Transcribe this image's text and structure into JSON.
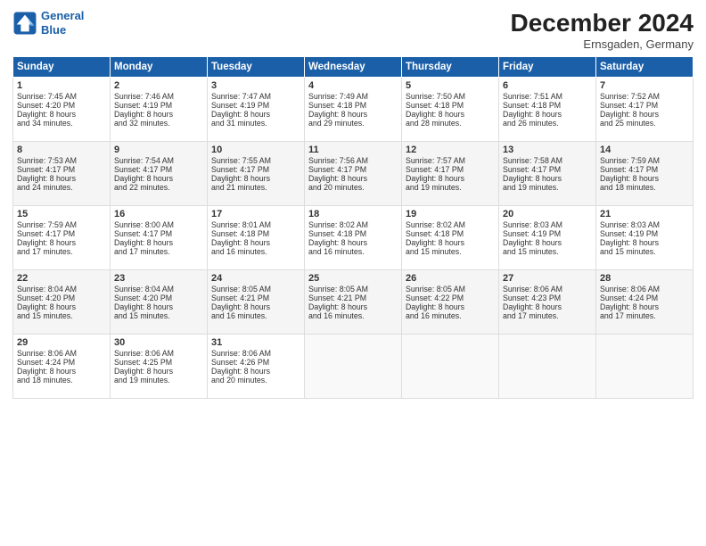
{
  "header": {
    "logo_line1": "General",
    "logo_line2": "Blue",
    "month": "December 2024",
    "location": "Ernsgaden, Germany"
  },
  "days_of_week": [
    "Sunday",
    "Monday",
    "Tuesday",
    "Wednesday",
    "Thursday",
    "Friday",
    "Saturday"
  ],
  "weeks": [
    [
      {
        "day": "1",
        "lines": [
          "Sunrise: 7:45 AM",
          "Sunset: 4:20 PM",
          "Daylight: 8 hours",
          "and 34 minutes."
        ]
      },
      {
        "day": "2",
        "lines": [
          "Sunrise: 7:46 AM",
          "Sunset: 4:19 PM",
          "Daylight: 8 hours",
          "and 32 minutes."
        ]
      },
      {
        "day": "3",
        "lines": [
          "Sunrise: 7:47 AM",
          "Sunset: 4:19 PM",
          "Daylight: 8 hours",
          "and 31 minutes."
        ]
      },
      {
        "day": "4",
        "lines": [
          "Sunrise: 7:49 AM",
          "Sunset: 4:18 PM",
          "Daylight: 8 hours",
          "and 29 minutes."
        ]
      },
      {
        "day": "5",
        "lines": [
          "Sunrise: 7:50 AM",
          "Sunset: 4:18 PM",
          "Daylight: 8 hours",
          "and 28 minutes."
        ]
      },
      {
        "day": "6",
        "lines": [
          "Sunrise: 7:51 AM",
          "Sunset: 4:18 PM",
          "Daylight: 8 hours",
          "and 26 minutes."
        ]
      },
      {
        "day": "7",
        "lines": [
          "Sunrise: 7:52 AM",
          "Sunset: 4:17 PM",
          "Daylight: 8 hours",
          "and 25 minutes."
        ]
      }
    ],
    [
      {
        "day": "8",
        "lines": [
          "Sunrise: 7:53 AM",
          "Sunset: 4:17 PM",
          "Daylight: 8 hours",
          "and 24 minutes."
        ]
      },
      {
        "day": "9",
        "lines": [
          "Sunrise: 7:54 AM",
          "Sunset: 4:17 PM",
          "Daylight: 8 hours",
          "and 22 minutes."
        ]
      },
      {
        "day": "10",
        "lines": [
          "Sunrise: 7:55 AM",
          "Sunset: 4:17 PM",
          "Daylight: 8 hours",
          "and 21 minutes."
        ]
      },
      {
        "day": "11",
        "lines": [
          "Sunrise: 7:56 AM",
          "Sunset: 4:17 PM",
          "Daylight: 8 hours",
          "and 20 minutes."
        ]
      },
      {
        "day": "12",
        "lines": [
          "Sunrise: 7:57 AM",
          "Sunset: 4:17 PM",
          "Daylight: 8 hours",
          "and 19 minutes."
        ]
      },
      {
        "day": "13",
        "lines": [
          "Sunrise: 7:58 AM",
          "Sunset: 4:17 PM",
          "Daylight: 8 hours",
          "and 19 minutes."
        ]
      },
      {
        "day": "14",
        "lines": [
          "Sunrise: 7:59 AM",
          "Sunset: 4:17 PM",
          "Daylight: 8 hours",
          "and 18 minutes."
        ]
      }
    ],
    [
      {
        "day": "15",
        "lines": [
          "Sunrise: 7:59 AM",
          "Sunset: 4:17 PM",
          "Daylight: 8 hours",
          "and 17 minutes."
        ]
      },
      {
        "day": "16",
        "lines": [
          "Sunrise: 8:00 AM",
          "Sunset: 4:17 PM",
          "Daylight: 8 hours",
          "and 17 minutes."
        ]
      },
      {
        "day": "17",
        "lines": [
          "Sunrise: 8:01 AM",
          "Sunset: 4:18 PM",
          "Daylight: 8 hours",
          "and 16 minutes."
        ]
      },
      {
        "day": "18",
        "lines": [
          "Sunrise: 8:02 AM",
          "Sunset: 4:18 PM",
          "Daylight: 8 hours",
          "and 16 minutes."
        ]
      },
      {
        "day": "19",
        "lines": [
          "Sunrise: 8:02 AM",
          "Sunset: 4:18 PM",
          "Daylight: 8 hours",
          "and 15 minutes."
        ]
      },
      {
        "day": "20",
        "lines": [
          "Sunrise: 8:03 AM",
          "Sunset: 4:19 PM",
          "Daylight: 8 hours",
          "and 15 minutes."
        ]
      },
      {
        "day": "21",
        "lines": [
          "Sunrise: 8:03 AM",
          "Sunset: 4:19 PM",
          "Daylight: 8 hours",
          "and 15 minutes."
        ]
      }
    ],
    [
      {
        "day": "22",
        "lines": [
          "Sunrise: 8:04 AM",
          "Sunset: 4:20 PM",
          "Daylight: 8 hours",
          "and 15 minutes."
        ]
      },
      {
        "day": "23",
        "lines": [
          "Sunrise: 8:04 AM",
          "Sunset: 4:20 PM",
          "Daylight: 8 hours",
          "and 15 minutes."
        ]
      },
      {
        "day": "24",
        "lines": [
          "Sunrise: 8:05 AM",
          "Sunset: 4:21 PM",
          "Daylight: 8 hours",
          "and 16 minutes."
        ]
      },
      {
        "day": "25",
        "lines": [
          "Sunrise: 8:05 AM",
          "Sunset: 4:21 PM",
          "Daylight: 8 hours",
          "and 16 minutes."
        ]
      },
      {
        "day": "26",
        "lines": [
          "Sunrise: 8:05 AM",
          "Sunset: 4:22 PM",
          "Daylight: 8 hours",
          "and 16 minutes."
        ]
      },
      {
        "day": "27",
        "lines": [
          "Sunrise: 8:06 AM",
          "Sunset: 4:23 PM",
          "Daylight: 8 hours",
          "and 17 minutes."
        ]
      },
      {
        "day": "28",
        "lines": [
          "Sunrise: 8:06 AM",
          "Sunset: 4:24 PM",
          "Daylight: 8 hours",
          "and 17 minutes."
        ]
      }
    ],
    [
      {
        "day": "29",
        "lines": [
          "Sunrise: 8:06 AM",
          "Sunset: 4:24 PM",
          "Daylight: 8 hours",
          "and 18 minutes."
        ]
      },
      {
        "day": "30",
        "lines": [
          "Sunrise: 8:06 AM",
          "Sunset: 4:25 PM",
          "Daylight: 8 hours",
          "and 19 minutes."
        ]
      },
      {
        "day": "31",
        "lines": [
          "Sunrise: 8:06 AM",
          "Sunset: 4:26 PM",
          "Daylight: 8 hours",
          "and 20 minutes."
        ]
      },
      null,
      null,
      null,
      null
    ]
  ]
}
